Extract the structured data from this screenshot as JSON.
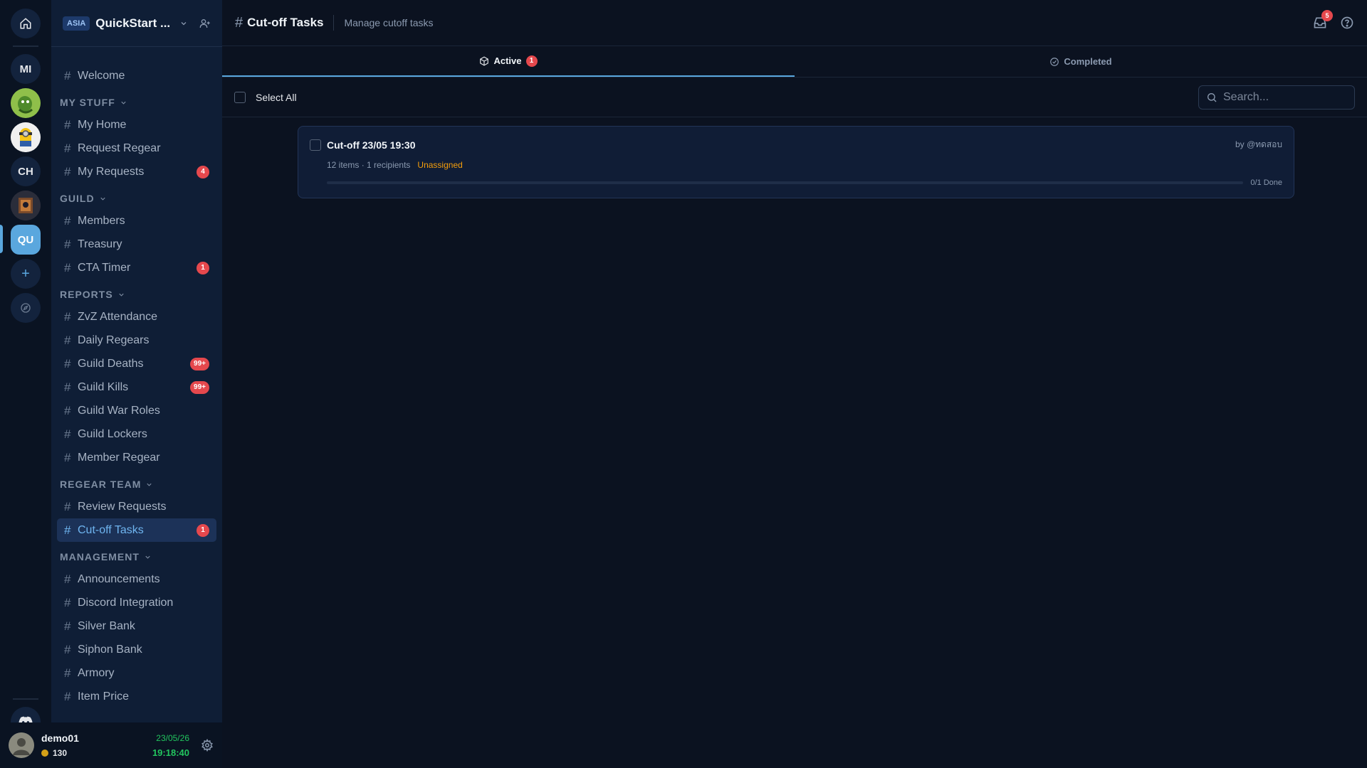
{
  "rail": {
    "servers": [
      {
        "label": "MI"
      },
      {
        "label": ""
      },
      {
        "label": ""
      },
      {
        "label": "CH"
      },
      {
        "label": ""
      },
      {
        "label": "QU"
      }
    ],
    "add_symbol": "+"
  },
  "guild": {
    "region": "ASIA",
    "name": "QuickStart ..."
  },
  "channels": {
    "top": [
      {
        "label": "Welcome"
      }
    ],
    "sections": [
      {
        "title": "MY STUFF",
        "items": [
          {
            "label": "My Home",
            "badge": ""
          },
          {
            "label": "Request Regear",
            "badge": ""
          },
          {
            "label": "My Requests",
            "badge": "4"
          }
        ]
      },
      {
        "title": "GUILD",
        "items": [
          {
            "label": "Members",
            "badge": ""
          },
          {
            "label": "Treasury",
            "badge": ""
          },
          {
            "label": "CTA Timer",
            "badge": "1"
          }
        ]
      },
      {
        "title": "REPORTS",
        "items": [
          {
            "label": "ZvZ Attendance",
            "badge": ""
          },
          {
            "label": "Daily Regears",
            "badge": ""
          },
          {
            "label": "Guild Deaths",
            "badge": "99+"
          },
          {
            "label": "Guild Kills",
            "badge": "99+"
          },
          {
            "label": "Guild War Roles",
            "badge": ""
          },
          {
            "label": "Guild Lockers",
            "badge": ""
          },
          {
            "label": "Member Regear",
            "badge": ""
          }
        ]
      },
      {
        "title": "REGEAR TEAM",
        "items": [
          {
            "label": "Review Requests",
            "badge": ""
          },
          {
            "label": "Cut-off Tasks",
            "badge": "1"
          }
        ]
      },
      {
        "title": "MANAGEMENT",
        "items": [
          {
            "label": "Announcements",
            "badge": ""
          },
          {
            "label": "Discord Integration",
            "badge": ""
          },
          {
            "label": "Silver Bank",
            "badge": ""
          },
          {
            "label": "Siphon Bank",
            "badge": ""
          },
          {
            "label": "Armory",
            "badge": ""
          },
          {
            "label": "Item Price",
            "badge": ""
          }
        ]
      }
    ]
  },
  "user": {
    "name": "demo01",
    "coins": "130",
    "date": "23/05/26",
    "time": "19:18:40"
  },
  "header": {
    "hash": "#",
    "title": "Cut-off Tasks",
    "subtitle": "Manage cutoff tasks",
    "notifications": "5"
  },
  "tabs": [
    {
      "label": "Active",
      "badge": "1"
    },
    {
      "label": "Completed"
    }
  ],
  "toolbar": {
    "select_all": "Select All",
    "search_placeholder": "Search..."
  },
  "task": {
    "title": "Cut-off 23/05 19:30",
    "by": "by @ทดสอบ",
    "items": "12 items",
    "recipients": "1 recipients",
    "separator": "·",
    "status": "Unassigned",
    "progress_fraction": 0,
    "done_text": "0/1 Done"
  },
  "colors": {
    "accent": "#5aa7de",
    "badge": "#e5484d",
    "status_unassigned": "#f59e0b",
    "time_green": "#22c55e"
  }
}
